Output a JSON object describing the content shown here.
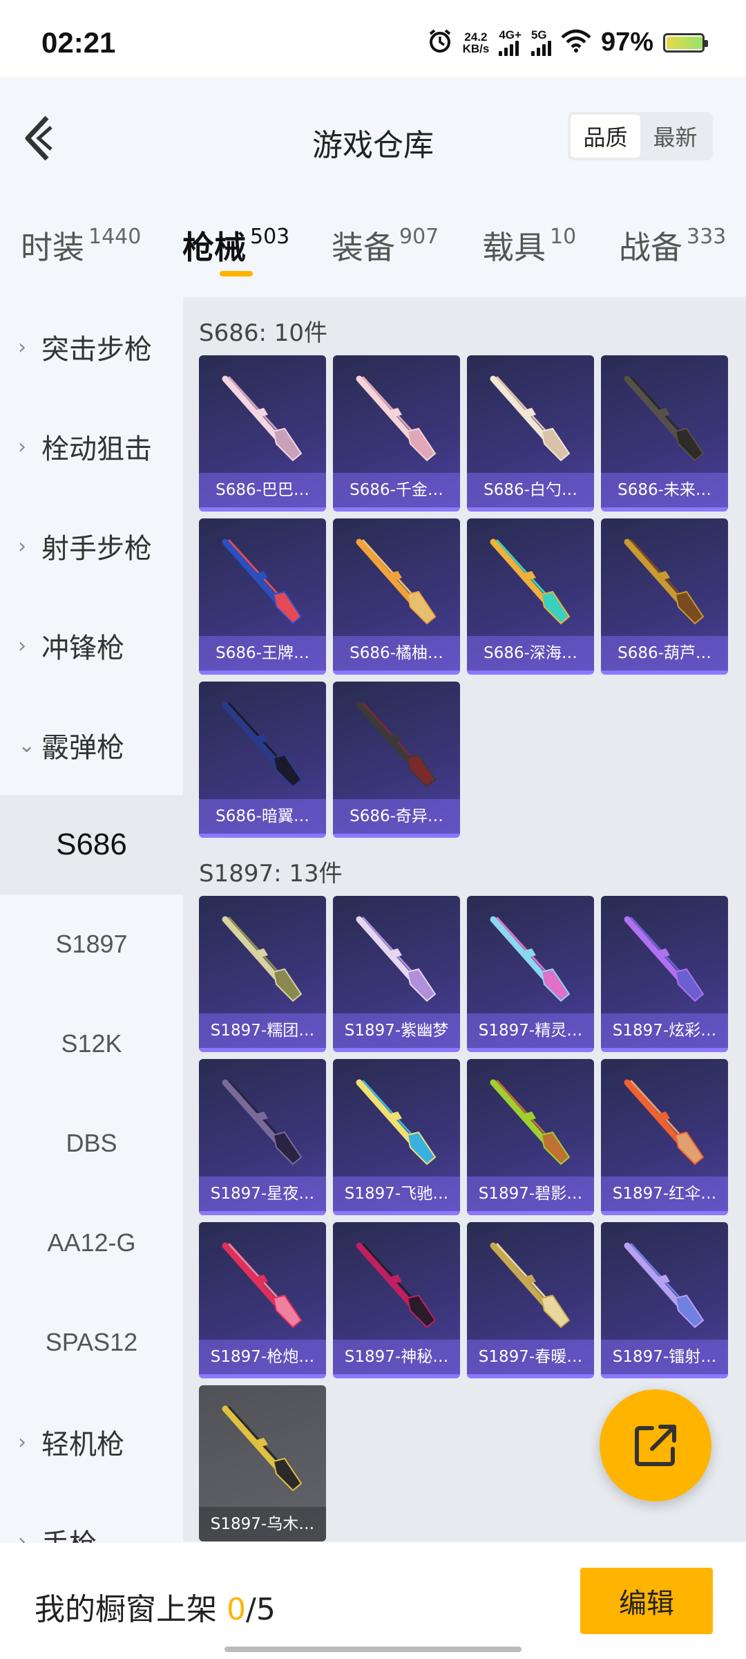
{
  "status_bar": {
    "time": "02:21",
    "net_speed_value": "24.2",
    "net_speed_unit": "KB/s",
    "sim1": "4G+",
    "sim2": "5G",
    "battery_pct": "97%",
    "battery_level": 0.97
  },
  "header": {
    "title": "游戏仓库",
    "sort_options": [
      "品质",
      "最新"
    ],
    "sort_selected": "品质"
  },
  "tabs": [
    {
      "label": "时装",
      "count": "1440"
    },
    {
      "label": "枪械",
      "count": "503"
    },
    {
      "label": "装备",
      "count": "907"
    },
    {
      "label": "载具",
      "count": "10"
    },
    {
      "label": "战备",
      "count": "333"
    }
  ],
  "active_tab": "枪械",
  "sidebar": {
    "categories": [
      {
        "label": "突击步枪",
        "chevron": "›"
      },
      {
        "label": "栓动狙击",
        "chevron": "›"
      },
      {
        "label": "射手步枪",
        "chevron": "›"
      },
      {
        "label": "冲锋枪",
        "chevron": "›"
      },
      {
        "label": "霰弹枪",
        "chevron": "⌄"
      }
    ],
    "subitems": [
      "S686",
      "S1897",
      "S12K",
      "DBS",
      "AA12-G",
      "SPAS12"
    ],
    "selected_subitem": "S686",
    "more_categories": [
      {
        "label": "轻机枪",
        "chevron": "›"
      },
      {
        "label": "手枪",
        "chevron": "›"
      }
    ]
  },
  "sections": [
    {
      "title": "S686: 10件",
      "items": [
        {
          "label": "S686-巴巴…",
          "colors": [
            "#f3d6e2",
            "#c9a0b8"
          ]
        },
        {
          "label": "S686-千金…",
          "colors": [
            "#f5d3d8",
            "#e0a7b7"
          ]
        },
        {
          "label": "S686-白勺…",
          "colors": [
            "#f2e6d6",
            "#d8c2a8"
          ]
        },
        {
          "label": "S686-未来…",
          "colors": [
            "#55504a",
            "#2d2a28"
          ]
        },
        {
          "label": "S686-王牌…",
          "colors": [
            "#2a4fc0",
            "#e24a5a"
          ]
        },
        {
          "label": "S686-橘柚…",
          "colors": [
            "#f2a23a",
            "#e6c070"
          ]
        },
        {
          "label": "S686-深海…",
          "colors": [
            "#f0b03a",
            "#3ad0c0"
          ]
        },
        {
          "label": "S686-葫芦…",
          "colors": [
            "#c89a30",
            "#7a4a20"
          ]
        },
        {
          "label": "S686-暗翼…",
          "colors": [
            "#2a3a8a",
            "#1a1a2a"
          ]
        },
        {
          "label": "S686-奇异…",
          "colors": [
            "#3a3a3a",
            "#7a2a2a"
          ]
        }
      ]
    },
    {
      "title": "S1897: 13件",
      "items": [
        {
          "label": "S1897-糯团…",
          "colors": [
            "#d8d2a0",
            "#8a8a50"
          ]
        },
        {
          "label": "S1897-紫幽梦",
          "colors": [
            "#e6d6f0",
            "#b090d8"
          ]
        },
        {
          "label": "S1897-精灵…",
          "colors": [
            "#8ad8f0",
            "#e070c8"
          ]
        },
        {
          "label": "S1897-炫彩…",
          "colors": [
            "#b070f0",
            "#6a60d0"
          ]
        },
        {
          "label": "S1897-星夜…",
          "colors": [
            "#7a6a9a",
            "#2a2440"
          ]
        },
        {
          "label": "S1897-飞驰…",
          "colors": [
            "#f0e070",
            "#3ab0e0"
          ]
        },
        {
          "label": "S1897-碧影…",
          "colors": [
            "#a0d030",
            "#c07030"
          ]
        },
        {
          "label": "S1897-红伞…",
          "colors": [
            "#f06030",
            "#e0a070"
          ]
        },
        {
          "label": "S1897-枪炮…",
          "colors": [
            "#e0305a",
            "#f080a0"
          ]
        },
        {
          "label": "S1897-神秘…",
          "colors": [
            "#c02060",
            "#2a1a2a"
          ]
        },
        {
          "label": "S1897-春暖…",
          "colors": [
            "#c8a850",
            "#e8d8a0"
          ]
        },
        {
          "label": "S1897-镭射…",
          "colors": [
            "#b8a0f0",
            "#7080e0"
          ]
        },
        {
          "label": "S1897-乌木…",
          "colors": [
            "#e0c040",
            "#2a2a2a"
          ],
          "gray": true
        }
      ]
    }
  ],
  "bottom_bar": {
    "prefix": "我的橱窗上架 ",
    "current": "0",
    "suffix": "/5",
    "edit_label": "编辑"
  },
  "colors": {
    "accent": "#ffb400",
    "card_bg": "#3a3578",
    "card_border": "#8b78ff"
  },
  "icons": {
    "back": "chevron-left-icon",
    "fab": "share-external-icon",
    "alarm": "alarm-icon",
    "wifi": "wifi-icon",
    "battery": "battery-icon"
  }
}
